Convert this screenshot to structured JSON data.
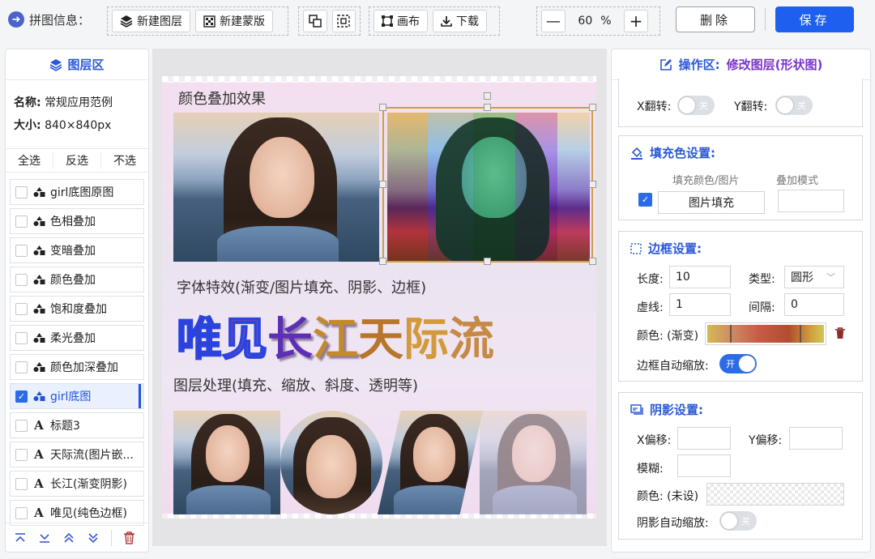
{
  "toolbar": {
    "title": "拼图信息：",
    "new_layer": "新建图层",
    "new_mask": "新建蒙版",
    "canvas": "画布",
    "download": "下载",
    "zoom_value": "60",
    "zoom_unit": "%",
    "delete": "删除",
    "save": "保存"
  },
  "layers_panel": {
    "title": "图层区",
    "name_label": "名称:",
    "name_value": "常规应用范例",
    "size_label": "大小:",
    "size_value": "840×840px",
    "select_all": "全选",
    "invert": "反选",
    "select_none": "不选",
    "items": [
      {
        "label": "girl底图原图",
        "type": "shape",
        "checked": false,
        "selected": false
      },
      {
        "label": "色相叠加",
        "type": "shape",
        "checked": false,
        "selected": false
      },
      {
        "label": "变暗叠加",
        "type": "shape",
        "checked": false,
        "selected": false
      },
      {
        "label": "颜色叠加",
        "type": "shape",
        "checked": false,
        "selected": false
      },
      {
        "label": "饱和度叠加",
        "type": "shape",
        "checked": false,
        "selected": false
      },
      {
        "label": "柔光叠加",
        "type": "shape",
        "checked": false,
        "selected": false
      },
      {
        "label": "颜色加深叠加",
        "type": "shape",
        "checked": false,
        "selected": false
      },
      {
        "label": "girl底图",
        "type": "shape",
        "checked": true,
        "selected": true
      },
      {
        "label": "标题3",
        "type": "text",
        "checked": false,
        "selected": false
      },
      {
        "label": "天际流(图片嵌...",
        "type": "text",
        "checked": false,
        "selected": false
      },
      {
        "label": "长江(渐变阴影)",
        "type": "text",
        "checked": false,
        "selected": false
      },
      {
        "label": "唯见(纯色边框)",
        "type": "text",
        "checked": false,
        "selected": false
      }
    ]
  },
  "canvas": {
    "section1_title": "颜色叠加效果",
    "section2_title": "字体特效(渐变/图片填充、阴影、边框)",
    "section3_title": "图层处理(填充、缩放、斜度、透明等)",
    "big_chars": [
      "唯",
      "见",
      "长",
      "江",
      "天",
      "际",
      "流"
    ]
  },
  "properties": {
    "title": "操作区:",
    "edit_label": "修改图层(形状图)",
    "flip": {
      "x_label": "X翻转:",
      "x_value": "关",
      "y_label": "Y翻转:",
      "y_value": "关"
    },
    "fill": {
      "title": "填充色设置:",
      "color_image_label": "填充颜色/图片",
      "blend_mode_label": "叠加模式",
      "fill_button": "图片填充",
      "checked": true,
      "blend_mode_value": ""
    },
    "border": {
      "title": "边框设置:",
      "length_label": "长度:",
      "length_value": "10",
      "type_label": "类型:",
      "type_value": "圆形",
      "dash_label": "虚线:",
      "dash_value": "1",
      "gap_label": "间隔:",
      "gap_value": "0",
      "color_label": "颜色: (渐变)",
      "auto_scale_label": "边框自动缩放:",
      "auto_scale_value": "开"
    },
    "shadow": {
      "title": "阴影设置:",
      "x_offset_label": "X偏移:",
      "x_offset_value": "",
      "y_offset_label": "Y偏移:",
      "y_offset_value": "",
      "blur_label": "模糊:",
      "blur_value": "",
      "color_label": "颜色: (未设)",
      "auto_scale_label": "阴影自动缩放:",
      "auto_scale_value": "关"
    }
  },
  "colors": {
    "accent": "#2a58d6",
    "save_button": "#1f5ff0",
    "edit_label": "#7a35c9",
    "delete_icon": "#b14040"
  },
  "icons": [
    "circle-arrow-icon",
    "layers-icon",
    "mask-icon",
    "copy-icon",
    "crop-icon",
    "canvas-icon",
    "download-icon",
    "minus-icon",
    "plus-icon",
    "shape-icon",
    "text-icon",
    "move-top-icon",
    "move-bottom-icon",
    "move-up-icon",
    "move-down-icon",
    "trash-icon",
    "edit-icon",
    "fill-icon",
    "border-icon",
    "shadow-icon",
    "select-arrow-icon"
  ]
}
